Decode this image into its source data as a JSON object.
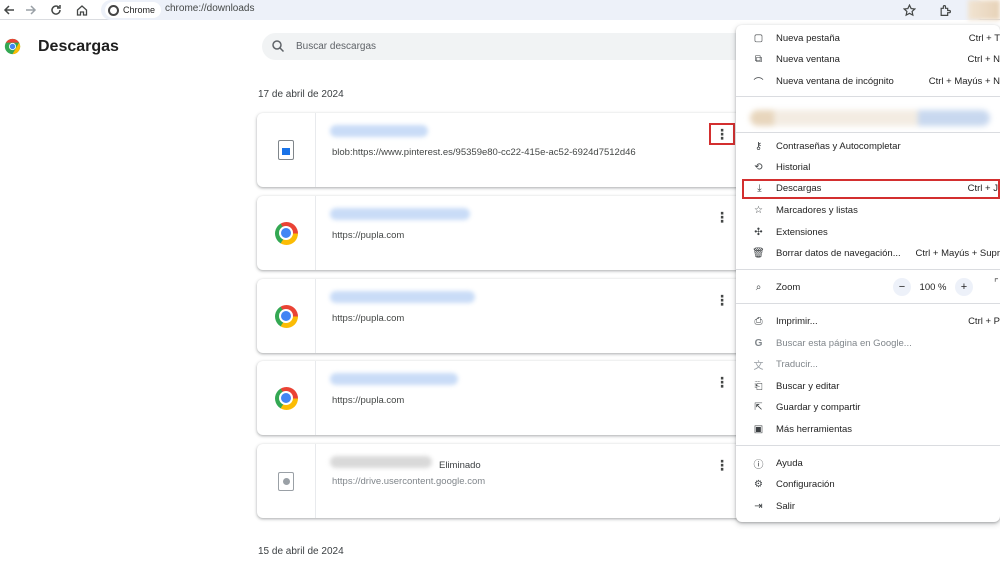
{
  "toolbar": {
    "back_icon": "arrow-left",
    "forward_icon": "arrow-right",
    "reload_icon": "reload",
    "home_icon": "home",
    "site_chip": "Chrome",
    "url": "chrome://downloads",
    "star_icon": "star",
    "extensions_icon": "puzzle"
  },
  "page": {
    "title": "Descargas",
    "search_placeholder": "Buscar descargas"
  },
  "groups": [
    {
      "date": "17 de abril de 2024",
      "items": [
        {
          "icon": "image-file",
          "name": "",
          "url": "blob:https://www.pinterest.es/95359e80-cc22-415e-ac52-6924d7512d46",
          "status": ""
        },
        {
          "icon": "chrome",
          "name": "",
          "url": "https://pupla.com",
          "status": ""
        },
        {
          "icon": "chrome",
          "name": "",
          "url": "https://pupla.com",
          "status": ""
        },
        {
          "icon": "chrome",
          "name": "",
          "url": "https://pupla.com",
          "status": ""
        },
        {
          "icon": "media-file",
          "name": "",
          "url": "https://drive.usercontent.google.com",
          "status": "Eliminado"
        }
      ]
    },
    {
      "date": "15 de abril de 2024",
      "items": []
    }
  ],
  "menu": {
    "new_tab": {
      "label": "Nueva pestaña",
      "shortcut": "Ctrl + T"
    },
    "new_window": {
      "label": "Nueva ventana",
      "shortcut": "Ctrl + N"
    },
    "incognito": {
      "label": "Nueva ventana de incógnito",
      "shortcut": "Ctrl + Mayús + N"
    },
    "passwords": {
      "label": "Contraseñas y Autocompletar"
    },
    "history": {
      "label": "Historial"
    },
    "downloads": {
      "label": "Descargas",
      "shortcut": "Ctrl + J"
    },
    "bookmarks": {
      "label": "Marcadores y listas"
    },
    "extensions": {
      "label": "Extensiones"
    },
    "clear_data": {
      "label": "Borrar datos de navegación...",
      "shortcut": "Ctrl + Mayús + Supr"
    },
    "zoom": {
      "label": "Zoom",
      "value": "100 %",
      "minus": "−",
      "plus": "+"
    },
    "print": {
      "label": "Imprimir...",
      "shortcut": "Ctrl + P"
    },
    "search_google": {
      "label": "Buscar esta página en Google..."
    },
    "translate": {
      "label": "Traducir..."
    },
    "find_edit": {
      "label": "Buscar y editar"
    },
    "save_share": {
      "label": "Guardar y compartir"
    },
    "more_tools": {
      "label": "Más herramientas"
    },
    "help": {
      "label": "Ayuda"
    },
    "settings": {
      "label": "Configuración"
    },
    "exit": {
      "label": "Salir"
    }
  },
  "colors": {
    "highlight": "#d32f2f",
    "accent": "#1a73e8"
  }
}
